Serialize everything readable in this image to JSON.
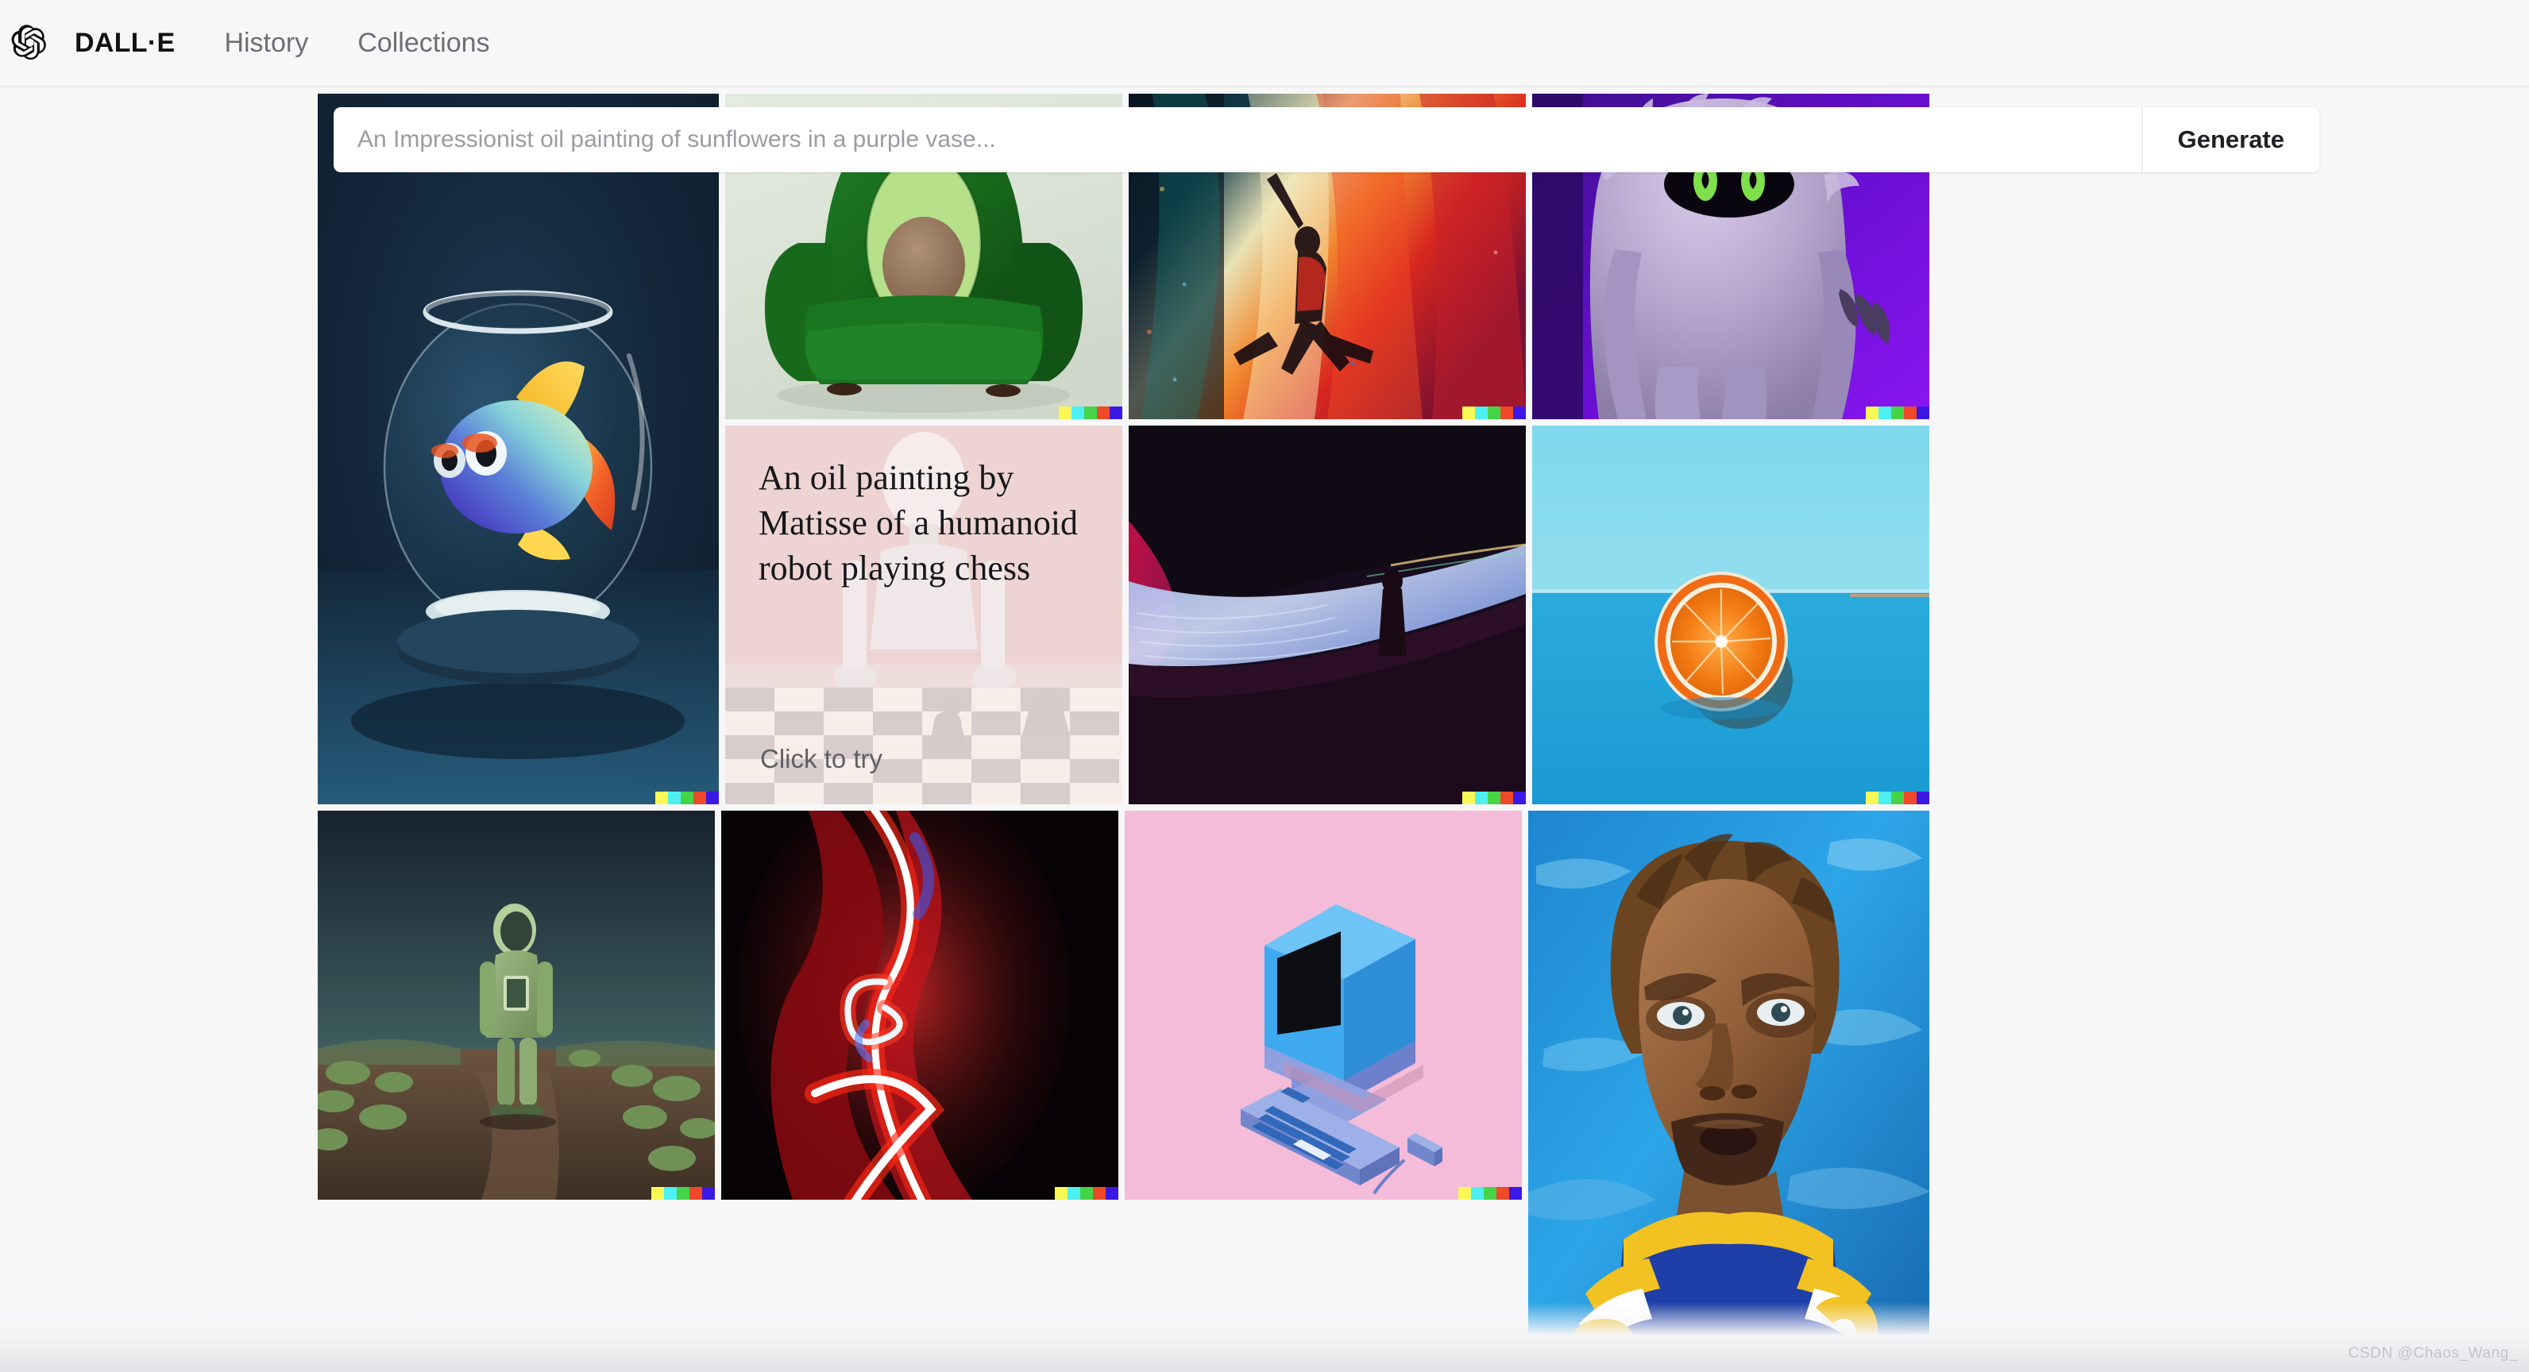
{
  "header": {
    "logo_icon": "openai-logo-icon",
    "brand": "DALL·E",
    "nav": [
      {
        "label": "History"
      },
      {
        "label": "Collections"
      }
    ]
  },
  "search": {
    "placeholder": "An Impressionist oil painting of sunflowers in a purple vase...",
    "value": "",
    "generate_label": "Generate"
  },
  "prompt_card": {
    "text": "An oil painting by Matisse of a humanoid robot playing chess",
    "cta": "Click to try",
    "background": "#fbeeec"
  },
  "signature_stripe": {
    "colors": [
      "#fbf855",
      "#4cf0f0",
      "#45d447",
      "#f0482b",
      "#3a18e6"
    ]
  },
  "gallery": {
    "tiles": [
      {
        "name": "fishbowl-fish",
        "caption": "3D render of a colorful fish inside a glass fishbowl on a blue background"
      },
      {
        "name": "avocado-armchair",
        "caption": "A green velvet armchair in the shape of an avocado"
      },
      {
        "name": "cosmic-dancer-painting",
        "caption": "A vivid impasto painting of a dancer leaping against a cosmic nebula"
      },
      {
        "name": "purple-furry-monster",
        "caption": "A purple furry monster with glowing green eyes"
      },
      {
        "name": "matisse-robot-chess-prompt",
        "caption": "Faded oil painting of a humanoid robot playing chess"
      },
      {
        "name": "figure-on-neon-dune",
        "caption": "A lone hooded figure standing on a neon-lit dune landscape"
      },
      {
        "name": "sliced-orange-on-blue",
        "caption": "A halved orange standing upright on a bright blue surface"
      },
      {
        "name": "astronaut-on-alien-terrain",
        "caption": "An astronaut in a green suit walking across alien terrain"
      },
      {
        "name": "neon-light-abstract",
        "caption": "Abstract red and white neon light swirls on black"
      },
      {
        "name": "retro-computer-isometric",
        "caption": "Isometric illustration of a retro blue computer on pink"
      },
      {
        "name": "painted-football-player-portrait",
        "caption": "Painterly portrait of a football player in a blue and gold jersey"
      }
    ]
  },
  "watermark": "CSDN @Chaos_Wang_"
}
